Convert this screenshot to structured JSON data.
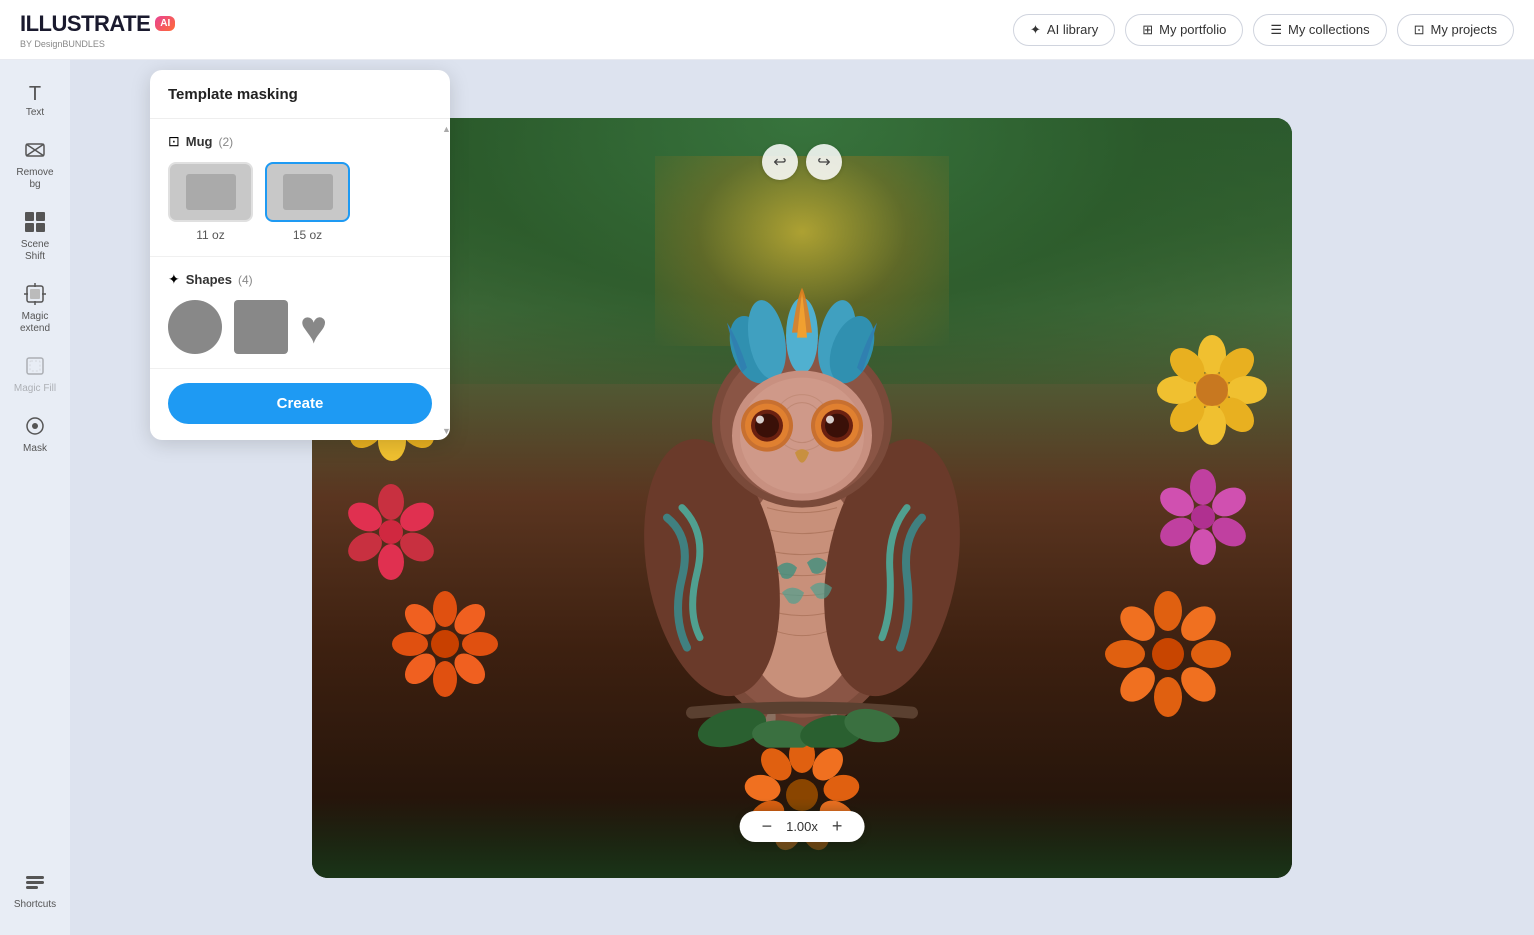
{
  "header": {
    "logo_text": "ILLUSTRATE",
    "logo_sub": "BY DesignBUNDLES",
    "nav_items": [
      {
        "id": "ai-library",
        "label": "AI library",
        "icon": "✦"
      },
      {
        "id": "my-portfolio",
        "label": "My portfolio",
        "icon": "⊞"
      },
      {
        "id": "my-collections",
        "label": "My collections",
        "icon": "☰"
      },
      {
        "id": "my-projects",
        "label": "My projects",
        "icon": "⊡"
      }
    ]
  },
  "sidebar": {
    "items": [
      {
        "id": "text",
        "label": "Text",
        "icon": "T"
      },
      {
        "id": "remove-bg",
        "label": "Remove bg",
        "icon": "⊟"
      },
      {
        "id": "scene-shift",
        "label": "Scene Shift",
        "icon": "▦"
      },
      {
        "id": "magic-extend",
        "label": "Magic extend",
        "icon": "⊞"
      },
      {
        "id": "magic-fill",
        "label": "Magic Fill",
        "icon": "⊡"
      },
      {
        "id": "mask",
        "label": "Mask",
        "icon": "⊙"
      },
      {
        "id": "shortcuts",
        "label": "Shortcuts",
        "icon": "⊟"
      }
    ]
  },
  "canvas": {
    "undo_label": "↩",
    "redo_label": "↪",
    "zoom_value": "1.00x",
    "zoom_minus": "−",
    "zoom_plus": "+"
  },
  "template_panel": {
    "title": "Template masking",
    "mug_section": {
      "label": "Mug",
      "count": "(2)",
      "icon": "⊡",
      "items": [
        {
          "label": "11 oz",
          "selected": false
        },
        {
          "label": "15 oz",
          "selected": true
        }
      ]
    },
    "shapes_section": {
      "label": "Shapes",
      "count": "(4)",
      "icon": "✦",
      "shapes": [
        "circle",
        "square",
        "heart"
      ]
    },
    "create_button": "Create"
  },
  "back_button": "‹"
}
